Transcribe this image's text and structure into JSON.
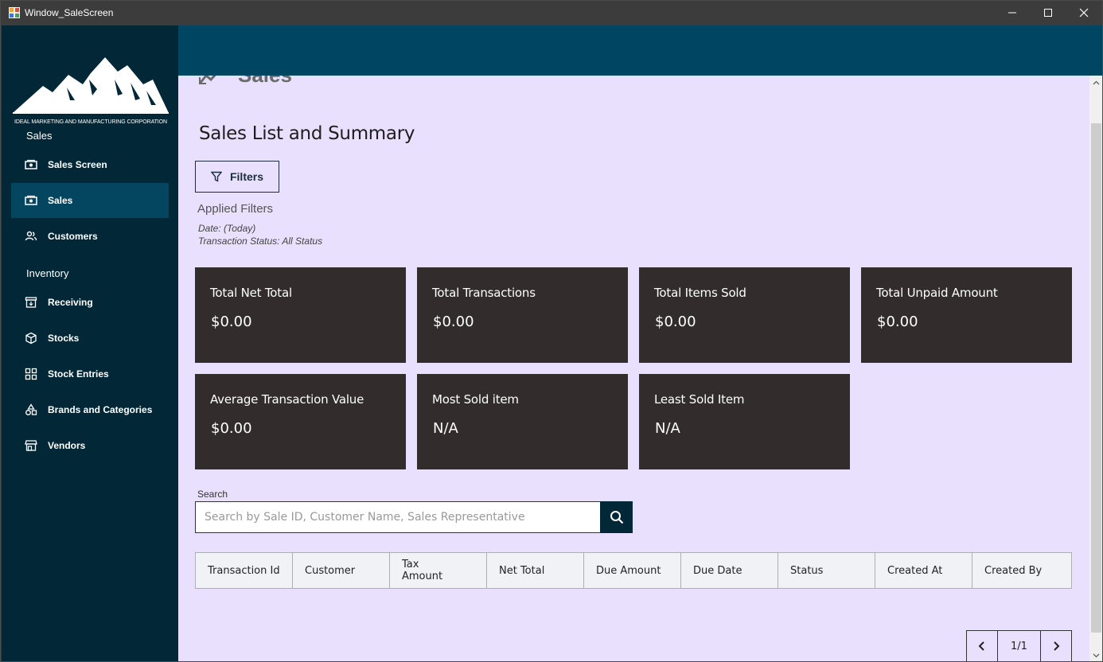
{
  "window": {
    "title": "Window_SaleScreen"
  },
  "sidebar": {
    "logo_text": "IDEAL MARKETING AND MANUFACTURING CORPORATION",
    "sections": [
      {
        "label": "Sales"
      },
      {
        "label": "Inventory"
      }
    ],
    "items": [
      {
        "label": "Sales Screen",
        "icon": "money-icon",
        "active": false
      },
      {
        "label": "Sales",
        "icon": "money-icon",
        "active": true
      },
      {
        "label": "Customers",
        "icon": "people-icon",
        "active": false
      },
      {
        "label": "Receiving",
        "icon": "archive-icon",
        "active": false
      },
      {
        "label": "Stocks",
        "icon": "box-icon",
        "active": false
      },
      {
        "label": "Stock Entries",
        "icon": "grid-icon",
        "active": false
      },
      {
        "label": "Brands and Categories",
        "icon": "shapes-icon",
        "active": false
      },
      {
        "label": "Vendors",
        "icon": "store-icon",
        "active": false
      }
    ]
  },
  "header": {
    "partial_title": "Sales"
  },
  "main": {
    "heading": "Sales List and Summary",
    "filters_button": "Filters",
    "applied_filters": {
      "title": "Applied Filters",
      "date": "Date:  (Today)",
      "status": "Transaction Status: All Status"
    },
    "cards": [
      {
        "label": "Total Net Total",
        "value": "$0.00"
      },
      {
        "label": "Total Transactions",
        "value": "$0.00"
      },
      {
        "label": "Total Items Sold",
        "value": "$0.00"
      },
      {
        "label": "Total Unpaid Amount",
        "value": "$0.00"
      },
      {
        "label": "Average Transaction Value",
        "value": "$0.00"
      },
      {
        "label": "Most Sold item",
        "value": "N/A"
      },
      {
        "label": "Least Sold Item",
        "value": "N/A"
      }
    ],
    "search": {
      "caption": "Search",
      "placeholder": "Search by Sale ID, Customer Name, Sales Representative",
      "value": ""
    },
    "table": {
      "columns": [
        "Transaction Id",
        "Customer",
        "Tax Amount",
        "Net Total",
        "Due Amount",
        "Due Date",
        "Status",
        "Created At",
        "Created By"
      ],
      "rows": []
    },
    "pagination": {
      "page_label": "1/1"
    }
  },
  "colors": {
    "sidebar_bg": "#022838",
    "active_item_bg": "#04455f",
    "top_band": "#004663",
    "content_bg": "#e9e0fe",
    "card_bg": "#332c2c"
  }
}
